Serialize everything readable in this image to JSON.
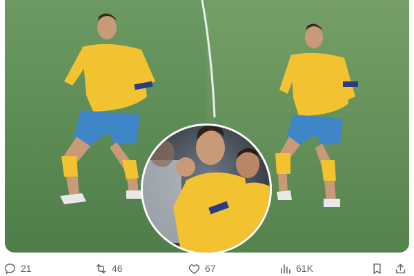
{
  "post": {
    "media": {
      "alt": "",
      "type": "image"
    },
    "actions": {
      "replies": {
        "icon": "reply-icon",
        "count": "21"
      },
      "reposts": {
        "icon": "repost-icon",
        "count": "46"
      },
      "likes": {
        "icon": "like-icon",
        "count": "67"
      },
      "views": {
        "icon": "views-icon",
        "count": "61K"
      },
      "bookmark": {
        "icon": "bookmark-icon"
      },
      "share": {
        "icon": "share-icon"
      }
    }
  },
  "colors": {
    "action_gray": "#536471",
    "pitch_green": "#5f8f59",
    "kit_yellow": "#f2c230",
    "shorts_blue": "#3f86c9"
  }
}
